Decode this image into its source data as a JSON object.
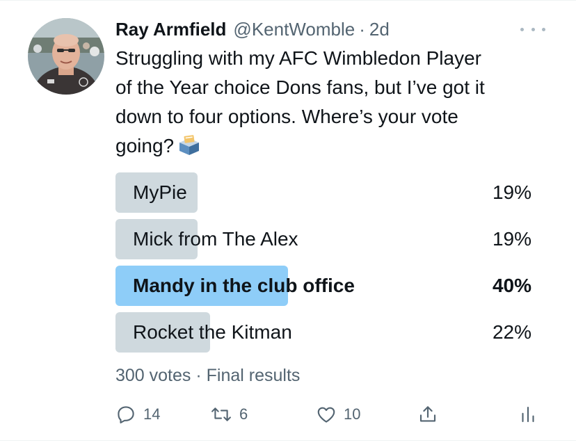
{
  "tweet": {
    "author": {
      "display_name": "Ray Armfield",
      "handle": "@KentWomble",
      "separator": "·",
      "time": "2d"
    },
    "text_lines": [
      "Struggling with my AFC Wimbledon Player",
      "of the Year choice Dons fans, but I’ve got it",
      "down to four options. Where’s your vote",
      "going?"
    ],
    "emoji": "ballot-box-icon"
  },
  "poll": {
    "options": [
      {
        "label": "MyPie",
        "percent_text": "19%",
        "percent": 19,
        "winner": false
      },
      {
        "label": "Mick from The Alex",
        "percent_text": "19%",
        "percent": 19,
        "winner": false
      },
      {
        "label": "Mandy in the club office",
        "percent_text": "40%",
        "percent": 40,
        "winner": true
      },
      {
        "label": "Rocket the Kitman",
        "percent_text": "22%",
        "percent": 22,
        "winner": false
      }
    ],
    "meta": "300 votes · Final results"
  },
  "actions": {
    "reply_count": "14",
    "retweet_count": "6",
    "like_count": "10"
  },
  "colors": {
    "bar": "#cfd9de",
    "winner_bar": "#8ecdf8",
    "secondary_text": "#536471",
    "primary_text": "#0f1419"
  }
}
